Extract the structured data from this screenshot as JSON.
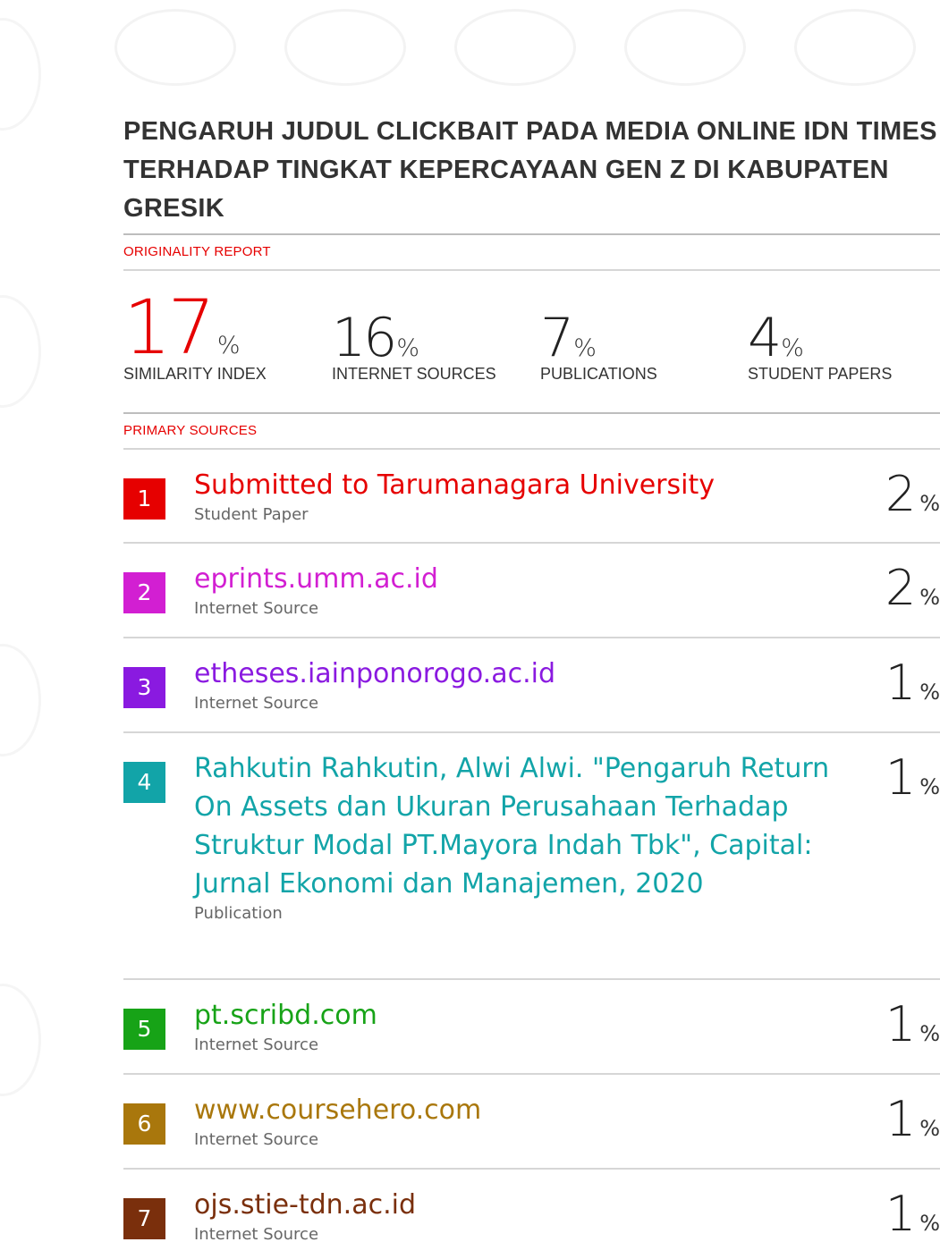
{
  "document": {
    "title": "PENGARUH JUDUL CLICKBAIT PADA MEDIA ONLINE IDN TIMES TERHADAP TINGKAT KEPERCAYAAN GEN Z DI KABUPATEN GRESIK"
  },
  "originality": {
    "label": "ORIGINALITY REPORT",
    "similarity": {
      "value": "17",
      "unit": "%",
      "label": "SIMILARITY INDEX"
    },
    "internet": {
      "value": "16",
      "unit": "%",
      "label": "INTERNET SOURCES"
    },
    "publications": {
      "value": "7",
      "unit": "%",
      "label": "PUBLICATIONS"
    },
    "student": {
      "value": "4",
      "unit": "%",
      "label": "STUDENT PAPERS"
    }
  },
  "primary_sources": {
    "label": "PRIMARY SOURCES",
    "items": [
      {
        "rank": "1",
        "name": "Submitted to Tarumanagara University",
        "type": "Student Paper",
        "percent": "2",
        "unit": "%",
        "color": "#e60000"
      },
      {
        "rank": "2",
        "name": "eprints.umm.ac.id",
        "type": "Internet Source",
        "percent": "2",
        "unit": "%",
        "color": "#d21fd2"
      },
      {
        "rank": "3",
        "name": "etheses.iainponorogo.ac.id",
        "type": "Internet Source",
        "percent": "1",
        "unit": "%",
        "color": "#8a1ae0"
      },
      {
        "rank": "4",
        "name": "Rahkutin Rahkutin, Alwi Alwi. \"Pengaruh Return On Assets dan Ukuran Perusahaan Terhadap Struktur Modal PT.Mayora Indah Tbk\", Capital: Jurnal Ekonomi dan Manajemen, 2020",
        "type": "Publication",
        "percent": "1",
        "unit": "%",
        "color": "#12a4a8"
      },
      {
        "rank": "5",
        "name": "pt.scribd.com",
        "type": "Internet Source",
        "percent": "1",
        "unit": "%",
        "color": "#17a317"
      },
      {
        "rank": "6",
        "name": "www.coursehero.com",
        "type": "Internet Source",
        "percent": "1",
        "unit": "%",
        "color": "#a9770c"
      },
      {
        "rank": "7",
        "name": "ojs.stie-tdn.ac.id",
        "type": "Internet Source",
        "percent": "1",
        "unit": "%",
        "color": "#7a2f0c"
      }
    ]
  }
}
